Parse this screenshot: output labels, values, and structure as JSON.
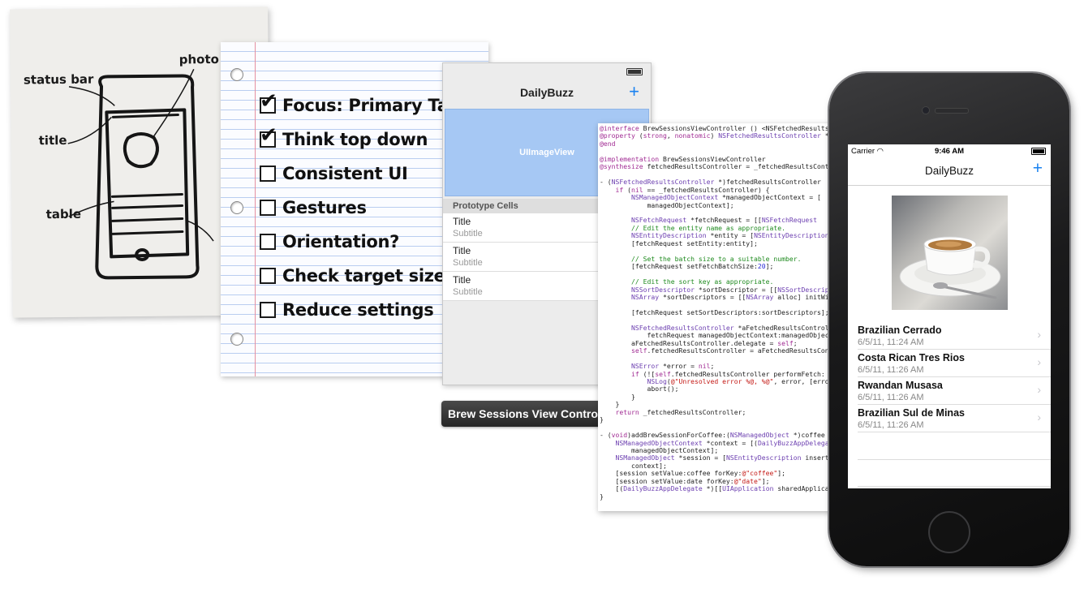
{
  "napkin": {
    "labels": [
      "status bar",
      "photo",
      "title",
      "table"
    ]
  },
  "checklist": {
    "items": [
      {
        "text": "Focus: Primary Target",
        "checked": true
      },
      {
        "text": "Think top down",
        "checked": true
      },
      {
        "text": "Consistent UI",
        "checked": false
      },
      {
        "text": "Gestures",
        "checked": false
      },
      {
        "text": "Orientation?",
        "checked": false
      },
      {
        "text": "Check target size",
        "checked": false
      },
      {
        "text": "Reduce settings",
        "checked": false
      }
    ]
  },
  "storyboard": {
    "nav_title": "DailyBuzz",
    "add_icon": "plus-icon",
    "image_view_label": "UIImageView",
    "section_header": "Prototype Cells",
    "cells": [
      {
        "title": "Title",
        "subtitle": "Subtitle"
      },
      {
        "title": "Title",
        "subtitle": "Subtitle"
      },
      {
        "title": "Title",
        "subtitle": "Subtitle"
      }
    ],
    "controller_label": "Brew Sessions View Controller"
  },
  "code": {
    "lines": [
      "@interface BrewSessionsViewController () <NSFetchedResultsControllerDelegate>",
      "@property (strong, nonatomic) NSFetchedResultsController *fetchedResultsController;",
      "@end",
      "",
      "@implementation BrewSessionsViewController",
      "@synthesize fetchedResultsController = _fetchedResultsController;",
      "",
      "- (NSFetchedResultsController *)fetchedResultsController",
      "    if (nil == _fetchedResultsController) {",
      "        NSManagedObjectContext *managedObjectContext = [",
      "            managedObjectContext];",
      "",
      "        NSFetchRequest *fetchRequest = [[NSFetchRequest",
      "        // Edit the entity name as appropriate.",
      "        NSEntityDescription *entity = [NSEntityDescription",
      "        [fetchRequest setEntity:entity];",
      "",
      "        // Set the batch size to a suitable number.",
      "        [fetchRequest setFetchBatchSize:20];",
      "",
      "        // Edit the sort key as appropriate.",
      "        NSSortDescriptor *sortDescriptor = [[NSSortDescriptor",
      "        NSArray *sortDescriptors = [[NSArray alloc] initWith",
      "",
      "        [fetchRequest setSortDescriptors:sortDescriptors];",
      "",
      "        NSFetchedResultsController *aFetchedResultsController",
      "            fetchRequest managedObjectContext:managedObjectContext",
      "        aFetchedResultsController.delegate = self;",
      "        self.fetchedResultsController = aFetchedResultsController;",
      "",
      "        NSError *error = nil;",
      "        if (![self.fetchedResultsController performFetch:",
      "            NSLog(@\"Unresolved error %@, %@\", error, [error",
      "            abort();",
      "        }",
      "    }",
      "    return _fetchedResultsController;",
      "}",
      "",
      "- (void)addBrewSessionForCoffee:(NSManagedObject *)coffee",
      "    NSManagedObjectContext *context = [(DailyBuzzAppDelegate",
      "        managedObjectContext];",
      "    NSManagedObject *session = [NSEntityDescription insert",
      "        context];",
      "    [session setValue:coffee forKey:@\"coffee\"];",
      "    [session setValue:date forKey:@\"date\"];",
      "    [(DailyBuzzAppDelegate *)[[UIApplication sharedApplication",
      "}"
    ]
  },
  "phone": {
    "carrier": "Carrier",
    "time": "9:46 AM",
    "nav_title": "DailyBuzz",
    "add_icon": "plus-icon",
    "rows": [
      {
        "name": "Brazilian Cerrado",
        "date": "6/5/11, 11:24 AM"
      },
      {
        "name": "Costa Rican Tres Rios",
        "date": "6/5/11, 11:26 AM"
      },
      {
        "name": "Rwandan Musasa",
        "date": "6/5/11, 11:26 AM"
      },
      {
        "name": "Brazilian Sul de Minas",
        "date": "6/5/11, 11:26 AM"
      }
    ]
  },
  "colors": {
    "ios_blue": "#1a82f0",
    "image_view_blue": "#a6c8f4",
    "paper_rule": "#b9cdf0",
    "paper_margin": "#e58fa0"
  }
}
